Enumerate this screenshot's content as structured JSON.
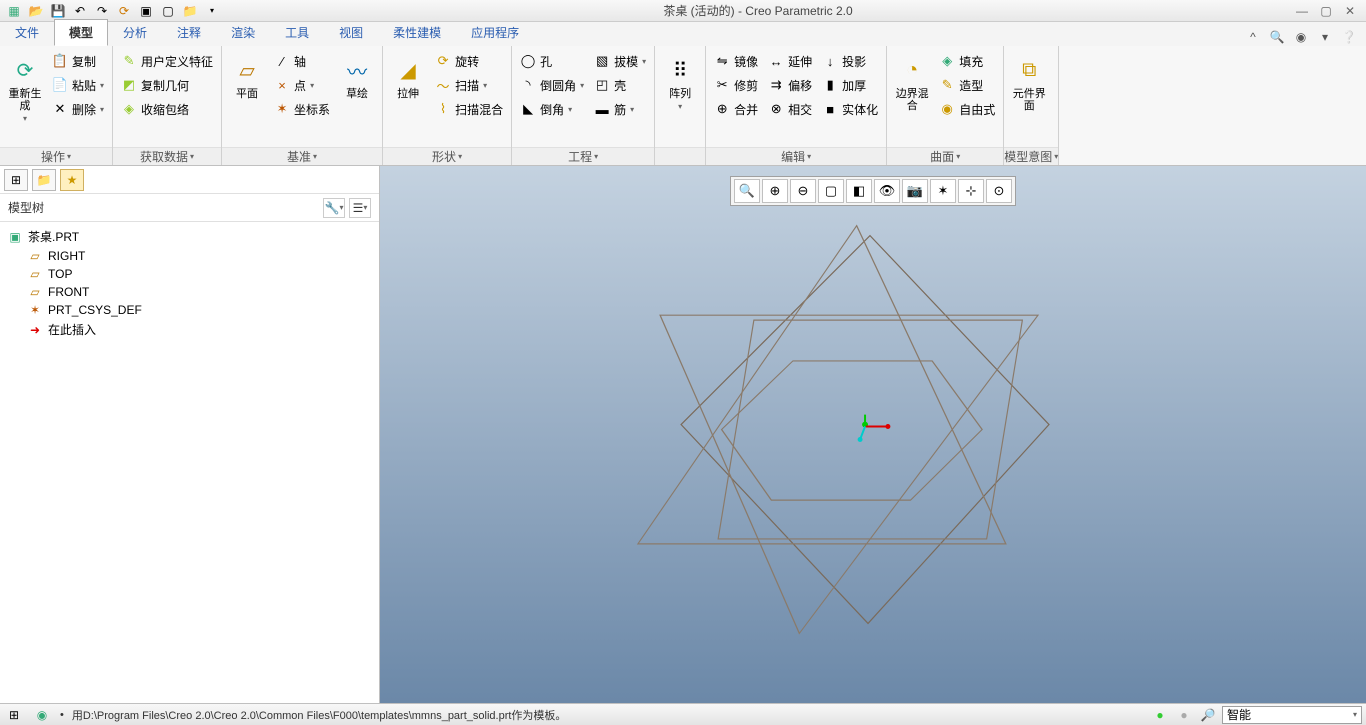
{
  "title": "茶桌 (活动的) - Creo Parametric 2.0",
  "tabs": {
    "file": "文件",
    "model": "模型",
    "analysis": "分析",
    "annotate": "注释",
    "render": "渲染",
    "tools": "工具",
    "view": "视图",
    "flex": "柔性建模",
    "app": "应用程序"
  },
  "ribbon": {
    "ops": {
      "label": "操作",
      "regen": "重新生成",
      "copy": "复制",
      "paste": "粘贴",
      "delete": "删除"
    },
    "getdata": {
      "label": "获取数据",
      "udf": "用户定义特征",
      "copygeo": "复制几何",
      "shrink": "收缩包络"
    },
    "datum": {
      "label": "基准",
      "plane": "平面",
      "axis": "轴",
      "point": "点",
      "csys": "坐标系",
      "sketch": "草绘"
    },
    "shape": {
      "label": "形状",
      "extrude": "拉伸",
      "revolve": "旋转",
      "sweep": "扫描",
      "sweepblend": "扫描混合"
    },
    "eng": {
      "label": "工程",
      "hole": "孔",
      "round": "倒圆角",
      "chamfer": "倒角",
      "draft": "拔模",
      "shell": "壳",
      "rib": "筋"
    },
    "pattern": {
      "label": "阵列",
      "intent": "阵列"
    },
    "edit": {
      "label": "编辑",
      "mirror": "镜像",
      "trim": "修剪",
      "merge": "合并",
      "extend": "延伸",
      "offset": "偏移",
      "intersect": "相交",
      "project": "投影",
      "thicken": "加厚",
      "solidify": "实体化"
    },
    "surf": {
      "label": "曲面",
      "bblend": "边界混合",
      "fill": "填充",
      "style": "造型",
      "freestyle": "自由式"
    },
    "intent2": {
      "label": "模型意图",
      "ui": "元件界面"
    }
  },
  "sidebar": {
    "header": "模型树",
    "root": "茶桌.PRT",
    "items": [
      {
        "icon": "▱",
        "label": "RIGHT"
      },
      {
        "icon": "▱",
        "label": "TOP"
      },
      {
        "icon": "▱",
        "label": "FRONT"
      },
      {
        "icon": "✶",
        "label": "PRT_CSYS_DEF"
      },
      {
        "icon": "➜",
        "label": "在此插入"
      }
    ]
  },
  "status": {
    "msg": "用D:\\Program Files\\Creo 2.0\\Creo 2.0\\Common Files\\F000\\templates\\mmns_part_solid.prt作为模板。",
    "filter": "智能"
  }
}
